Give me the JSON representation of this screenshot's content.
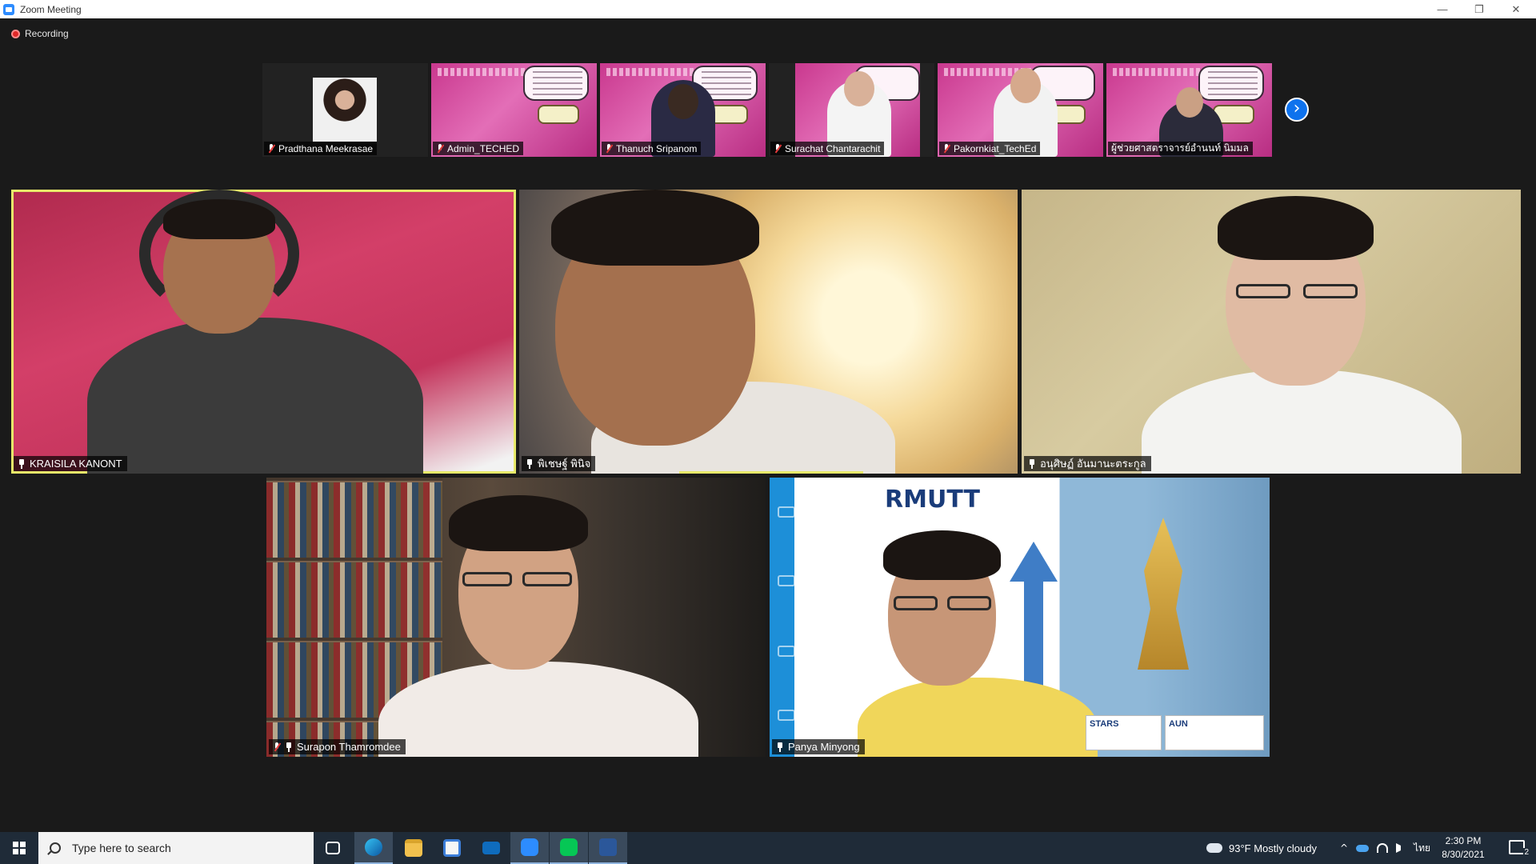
{
  "window": {
    "title": "Zoom Meeting",
    "minimize": "—",
    "restore": "❐",
    "close": "✕"
  },
  "recording": {
    "label": "Recording"
  },
  "thumbnails": [
    {
      "name": "Pradthana Meekrasae",
      "style": "photo"
    },
    {
      "name": "Admin_TECHED",
      "style": "pink"
    },
    {
      "name": "Thanuch Sripanom",
      "style": "pink"
    },
    {
      "name": "Surachat Chantarachit",
      "style": "pink"
    },
    {
      "name": "Pakornkiat_TechEd",
      "style": "pink"
    },
    {
      "name": "ผู้ช่วยศาสตราจารย์อำนนท์ นิมมล",
      "style": "pink"
    }
  ],
  "next_page_icon": "chevron-right-icon",
  "next_page_glyph": "›",
  "tiles": [
    {
      "name": "KRAISILA KANONT",
      "active": true
    },
    {
      "name": "พิเชษฐ์ พินิจ",
      "active": false
    },
    {
      "name": "อนุศิษฏ์ อันมานะตระกูล",
      "active": false
    },
    {
      "name": "Surapon Thamromdee",
      "active": false
    },
    {
      "name": "Panya Minyong",
      "active": false
    }
  ],
  "rmutt": {
    "logo_text": "RMUTT",
    "badge1": "STARS",
    "badge2": "AUN"
  },
  "taskbar": {
    "search_placeholder": "Type here to search",
    "apps": [
      "task-view-icon",
      "edge-icon",
      "file-explorer-icon",
      "store-icon",
      "mail-icon",
      "zoom-icon",
      "line-icon",
      "word-icon"
    ],
    "weather": "93°F  Mostly cloudy",
    "language": "ไทย",
    "time": "2:30 PM",
    "date": "8/30/2021",
    "notifications": "2"
  },
  "colors": {
    "accent": "#0e72ed",
    "active_speaker": "#e7e96a",
    "recording": "#e02828",
    "taskbar": "#1f2b38"
  }
}
